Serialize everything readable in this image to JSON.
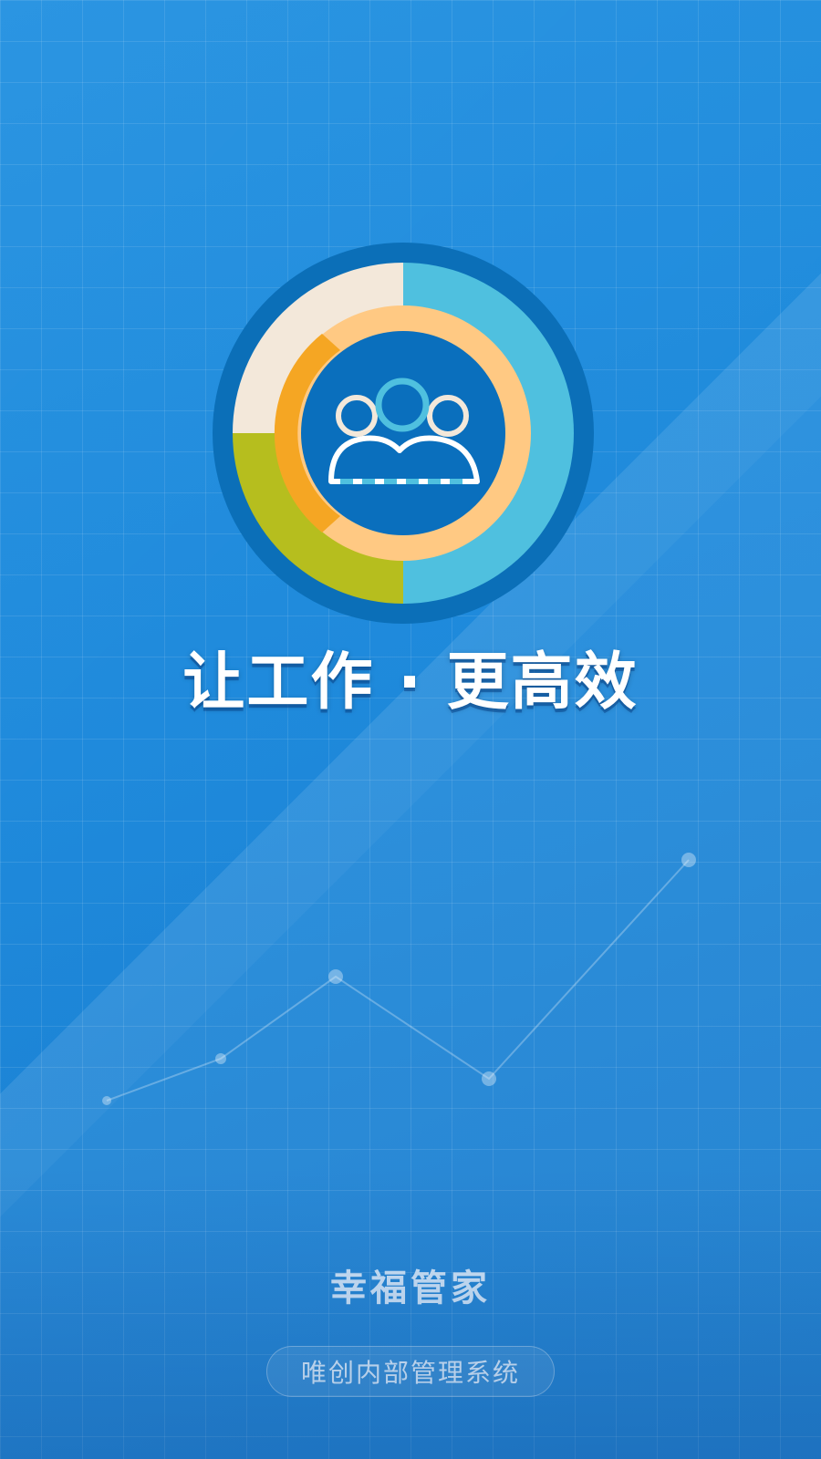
{
  "splash": {
    "headline": "让工作 · 更高效",
    "app_name": "幸福管家",
    "subtitle": "唯创内部管理系统"
  },
  "logo": {
    "icon": "people-group-icon"
  },
  "colors": {
    "background": "#1585da",
    "logo_outer_ring": "#0b6fb8",
    "logo_center": "#0a6fbd",
    "segment_cream": "#f3e8da",
    "segment_orange": "#f5a623",
    "segment_olive": "#b6be1e",
    "segment_peach": "#ffc983",
    "segment_cyan": "#4fc0df"
  }
}
